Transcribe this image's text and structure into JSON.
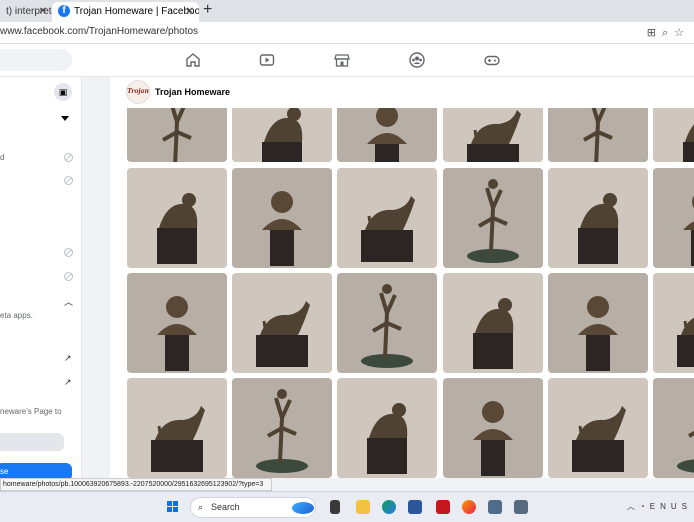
{
  "browser": {
    "tabs": [
      {
        "title": "t) interpret",
        "active": false
      },
      {
        "title": "Trojan Homeware | Facebook",
        "active": true
      }
    ],
    "new_tab_symbol": "+",
    "url": "www.facebook.com/TrojanHomeware/photos"
  },
  "fb_nav_icons": [
    "home-icon",
    "video-icon",
    "marketplace-icon",
    "groups-icon",
    "gaming-icon"
  ],
  "sidebar": {
    "texts": {
      "t1": "d",
      "t2": "eta apps.",
      "t3": "neware's Page to",
      "t4": "se"
    }
  },
  "page": {
    "name": "Trojan Homeware",
    "logo_text": "Trojan"
  },
  "status_url": "homeware/photos/pb.100063920675893.-2207520000/2951632695123902/?type=3",
  "taskbar": {
    "search_label": "Search",
    "tray_text": "ENUS"
  },
  "colors": {
    "facebook_blue": "#1877f2",
    "bronze": "#4f4232",
    "marble": "#2b2623"
  }
}
